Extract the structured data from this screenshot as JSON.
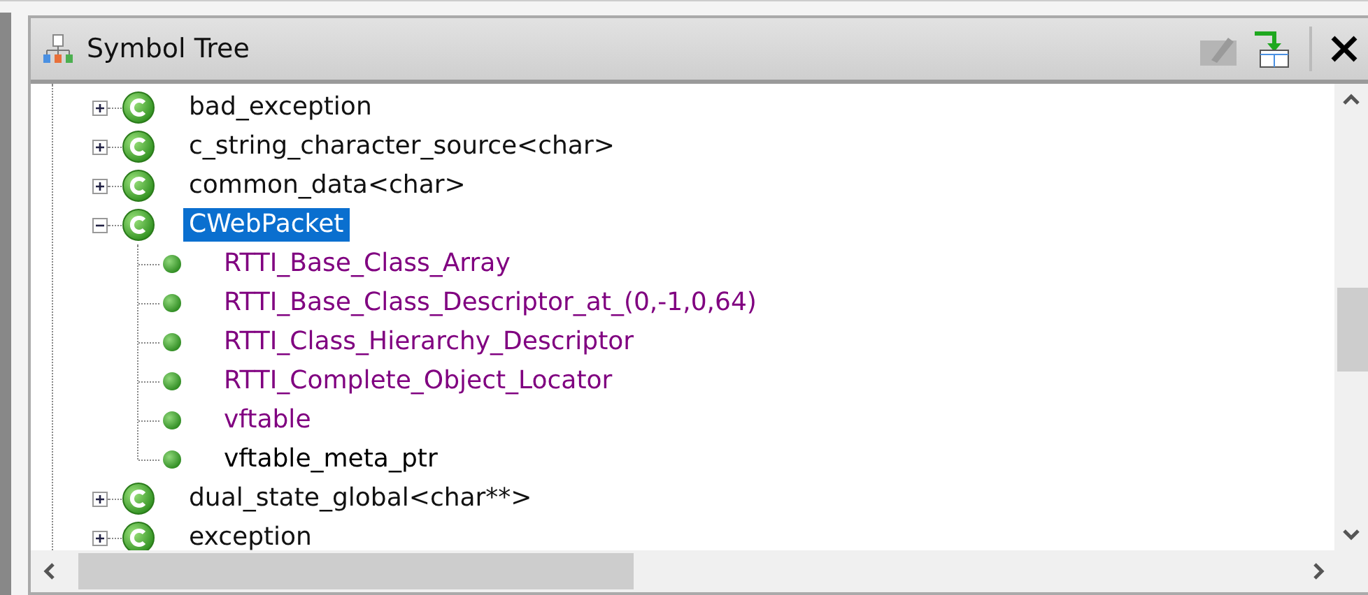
{
  "window": {
    "title": "Symbol Tree"
  },
  "tree": [
    {
      "label": "bad_exception",
      "expanded": false,
      "selected": false
    },
    {
      "label": "c_string_character_source<char>",
      "expanded": false,
      "selected": false
    },
    {
      "label": "common_data<char>",
      "expanded": false,
      "selected": false
    },
    {
      "label": "CWebPacket",
      "expanded": true,
      "selected": true,
      "children": [
        {
          "label": "RTTI_Base_Class_Array",
          "color": "#800080"
        },
        {
          "label": "RTTI_Base_Class_Descriptor_at_(0,-1,0,64)",
          "color": "#800080"
        },
        {
          "label": "RTTI_Class_Hierarchy_Descriptor",
          "color": "#800080"
        },
        {
          "label": "RTTI_Complete_Object_Locator",
          "color": "#800080"
        },
        {
          "label": "vftable",
          "color": "#800080"
        },
        {
          "label": "vftable_meta_ptr",
          "color": "#000000"
        }
      ]
    },
    {
      "label": "dual_state_global<char**>",
      "expanded": false,
      "selected": false
    },
    {
      "label": "exception",
      "expanded": false,
      "selected": false
    }
  ]
}
